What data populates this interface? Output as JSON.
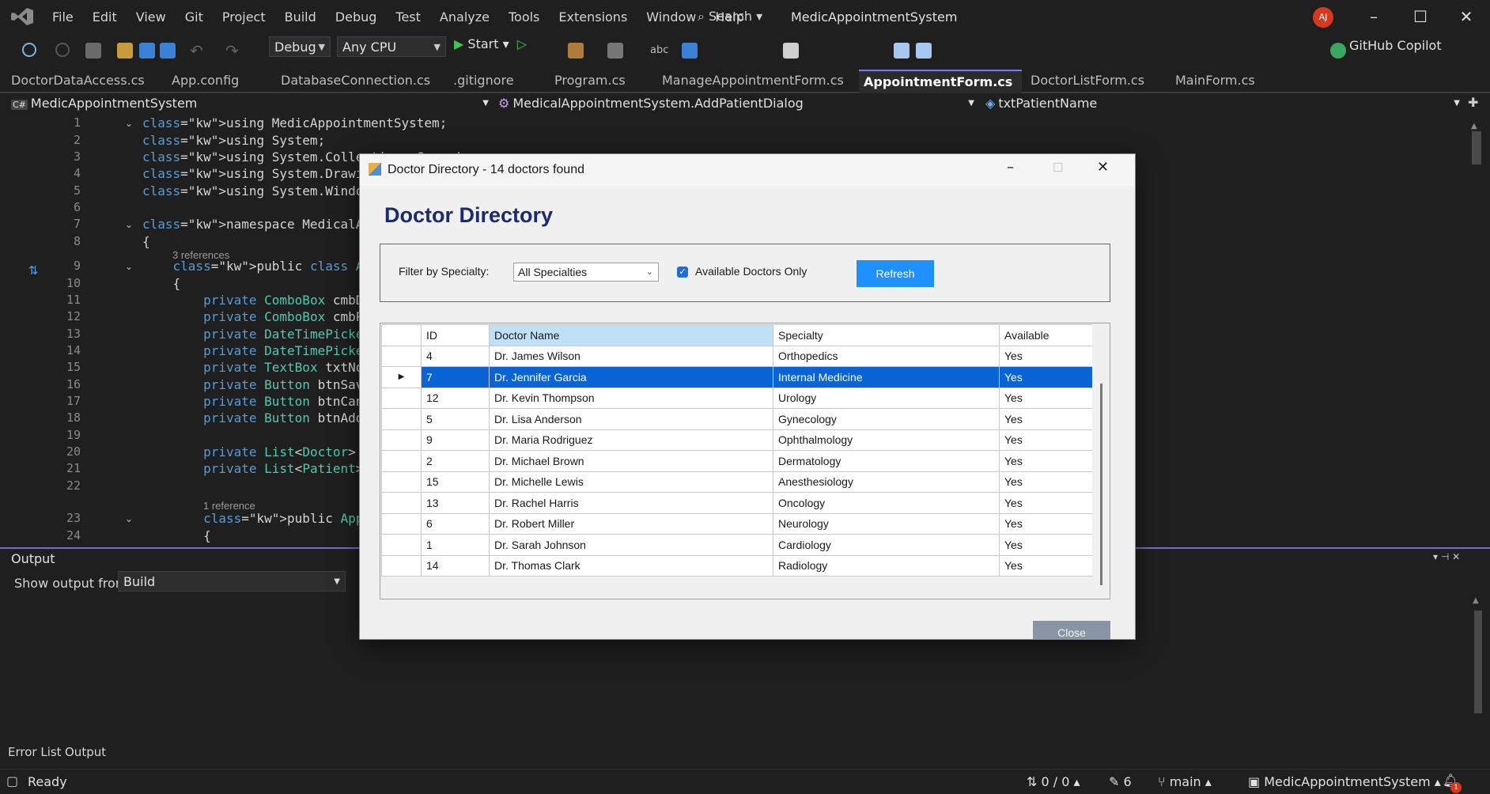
{
  "titlebar": {
    "menu": [
      "File",
      "Edit",
      "View",
      "Git",
      "Project",
      "Build",
      "Debug",
      "Test",
      "Analyze",
      "Tools",
      "Extensions",
      "Window",
      "Help"
    ],
    "search_label": "Search",
    "app_title": "MedicAppointmentSystem",
    "avatar_initials": "AJ"
  },
  "toolbar": {
    "config": "Debug",
    "platform": "Any CPU",
    "start_label": "Start",
    "copilot_label": "GitHub Copilot"
  },
  "tabs": [
    {
      "label": "DoctorDataAccess.cs"
    },
    {
      "label": "App.config"
    },
    {
      "label": "DatabaseConnection.cs"
    },
    {
      "label": ".gitignore"
    },
    {
      "label": "Program.cs"
    },
    {
      "label": "ManageAppointmentForm.cs"
    },
    {
      "label": "AppointmentForm.cs",
      "active": true
    },
    {
      "label": "DoctorListForm.cs"
    },
    {
      "label": "MainForm.cs"
    }
  ],
  "navbar": {
    "project": "MedicAppointmentSystem",
    "type": "MedicalAppointmentSystem.AddPatientDialog",
    "member": "txtPatientName"
  },
  "editor": {
    "lines": [
      {
        "n": "1",
        "text": "using MedicAppointmentSystem;"
      },
      {
        "n": "2",
        "text": "using System;"
      },
      {
        "n": "3",
        "text": "using System.Collections.Generic;"
      },
      {
        "n": "4",
        "text": "using System.Drawing;"
      },
      {
        "n": "5",
        "text": "using System.Windows.Forms;"
      },
      {
        "n": "6",
        "text": ""
      },
      {
        "n": "7",
        "text": "namespace MedicalAppointmentSystem"
      },
      {
        "n": "8",
        "text": "{"
      },
      {
        "n": "9",
        "text": "    public class AppointmentForm"
      },
      {
        "n": "10",
        "text": "    {"
      },
      {
        "n": "11",
        "text": "        private ComboBox cmbDoctor"
      },
      {
        "n": "12",
        "text": "        private ComboBox cmbPatient"
      },
      {
        "n": "13",
        "text": "        private DateTimePicker"
      },
      {
        "n": "14",
        "text": "        private DateTimePicker"
      },
      {
        "n": "15",
        "text": "        private TextBox txtNotes"
      },
      {
        "n": "16",
        "text": "        private Button btnSave"
      },
      {
        "n": "17",
        "text": "        private Button btnCancel"
      },
      {
        "n": "18",
        "text": "        private Button btnAdd"
      },
      {
        "n": "19",
        "text": ""
      },
      {
        "n": "20",
        "text": "        private List<Doctor>"
      },
      {
        "n": "21",
        "text": "        private List<Patient>"
      },
      {
        "n": "22",
        "text": ""
      },
      {
        "n": "23",
        "text": "        public AppointmentForm"
      },
      {
        "n": "24",
        "text": "        {"
      }
    ],
    "refs_3": "3 references",
    "refs_1": "1 reference"
  },
  "output": {
    "title": "Output",
    "show_from_label": "Show output from:",
    "source": "Build"
  },
  "bottom_tabs": [
    "Error List",
    "Output"
  ],
  "status": {
    "ready": "Ready",
    "lines": "0 / 0",
    "edits": "6",
    "branch": "main",
    "repo": "MedicAppointmentSystem",
    "notifications": "1"
  },
  "dialog": {
    "window_title": "Doctor Directory - 14 doctors found",
    "heading": "Doctor Directory",
    "filter_label": "Filter by Specialty:",
    "specialty": "All Specialties",
    "available_only_label": "Available Doctors Only",
    "available_only_checked": true,
    "refresh_label": "Refresh",
    "close_label": "Close",
    "columns": [
      "ID",
      "Doctor Name",
      "Specialty",
      "Available"
    ],
    "rows": [
      {
        "id": "4",
        "name": "Dr. James Wilson",
        "specialty": "Orthopedics",
        "available": "Yes"
      },
      {
        "id": "7",
        "name": "Dr. Jennifer Garcia",
        "specialty": "Internal Medicine",
        "available": "Yes",
        "selected": true
      },
      {
        "id": "12",
        "name": "Dr. Kevin Thompson",
        "specialty": "Urology",
        "available": "Yes"
      },
      {
        "id": "5",
        "name": "Dr. Lisa Anderson",
        "specialty": "Gynecology",
        "available": "Yes"
      },
      {
        "id": "9",
        "name": "Dr. Maria Rodriguez",
        "specialty": "Ophthalmology",
        "available": "Yes"
      },
      {
        "id": "2",
        "name": "Dr. Michael Brown",
        "specialty": "Dermatology",
        "available": "Yes"
      },
      {
        "id": "15",
        "name": "Dr. Michelle Lewis",
        "specialty": "Anesthesiology",
        "available": "Yes"
      },
      {
        "id": "13",
        "name": "Dr. Rachel Harris",
        "specialty": "Oncology",
        "available": "Yes"
      },
      {
        "id": "6",
        "name": "Dr. Robert Miller",
        "specialty": "Neurology",
        "available": "Yes"
      },
      {
        "id": "1",
        "name": "Dr. Sarah Johnson",
        "specialty": "Cardiology",
        "available": "Yes"
      },
      {
        "id": "14",
        "name": "Dr. Thomas Clark",
        "specialty": "Radiology",
        "available": "Yes"
      }
    ]
  }
}
